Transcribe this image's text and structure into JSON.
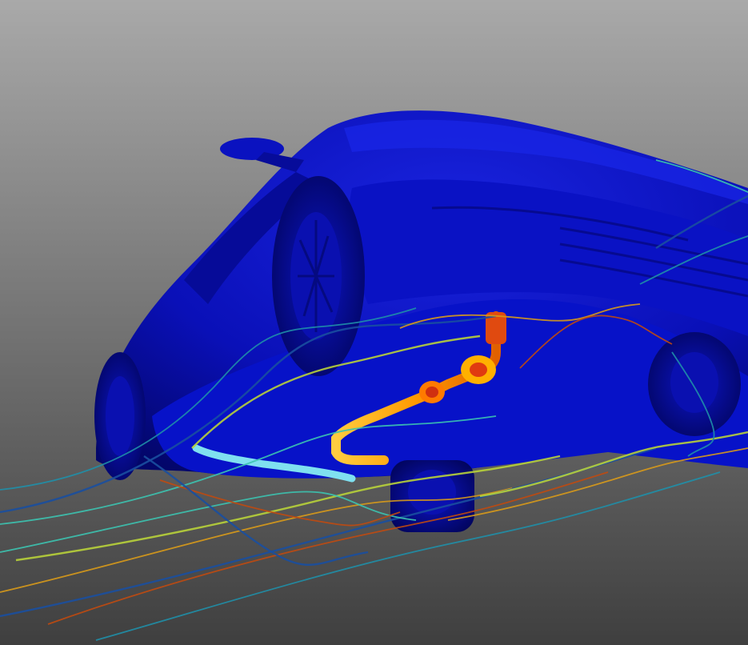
{
  "scene": {
    "subject": "car-underbody-cfd-streamlines",
    "background_top": "#a9a9a9",
    "background_bottom": "#3f3f3f",
    "body_color": "#0a10b8",
    "body_dark": "#050a7a",
    "body_light": "#1f2cf0",
    "exhaust_colors": [
      "#ffb000",
      "#ff7a00",
      "#e03a10",
      "#7fe0f0"
    ],
    "streamline_palette": [
      "#1a4fa0",
      "#1f8fa8",
      "#3cc3b0",
      "#b8d23a",
      "#d89a1a",
      "#c04a10"
    ]
  }
}
